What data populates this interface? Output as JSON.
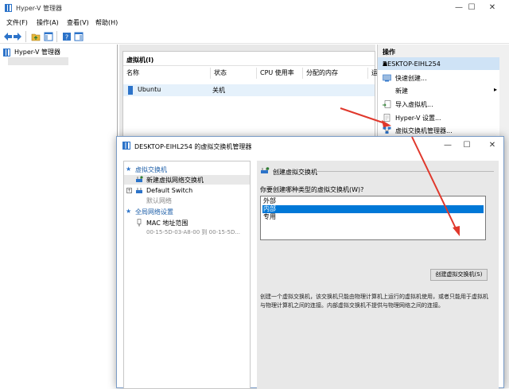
{
  "window": {
    "title": "Hyper-V 管理器",
    "controls": [
      "—",
      "☐",
      "✕"
    ]
  },
  "menu": [
    "文件(F)",
    "操作(A)",
    "查看(V)",
    "帮助(H)"
  ],
  "tree": {
    "root": "Hyper-V 管理器"
  },
  "vm_panel": {
    "title": "虚拟机(I)",
    "columns": [
      "名称",
      "状态",
      "CPU 使用率",
      "分配的内存",
      "运"
    ],
    "rows": [
      {
        "name": "Ubuntu",
        "state": "关机"
      }
    ]
  },
  "actions": {
    "header": "操作",
    "host": "DESKTOP-EIHL254",
    "items": [
      {
        "label": "快速创建...",
        "icon": "quick-create-icon"
      },
      {
        "label": "新建",
        "icon": "",
        "submenu": "▸"
      },
      {
        "label": "导入虚拟机...",
        "icon": "import-icon"
      },
      {
        "label": "Hyper-V 设置...",
        "icon": "settings-icon"
      },
      {
        "label": "虚拟交换机管理器...",
        "icon": "switch-manager-icon"
      }
    ]
  },
  "dialog": {
    "title": "DESKTOP-EIHL254 的虚拟交换机管理器",
    "controls": [
      "—",
      "☐",
      "✕"
    ],
    "left": {
      "section_switches": "虚拟交换机",
      "new_switch": "新建虚拟网络交换机",
      "default_switch": "Default Switch",
      "default_switch_sub": "默认网络",
      "section_global": "全局网络设置",
      "mac_range": "MAC 地址范围",
      "mac_value": "00-15-5D-03-A8-00 到 00-15-5D..."
    },
    "right": {
      "header": "创建虚拟交换机",
      "question": "你要创建哪种类型的虚拟交换机(W)?",
      "options": [
        "外部",
        "内部",
        "专用"
      ],
      "selected_index": 1,
      "create_button": "创建虚拟交换机(S)",
      "description": "创建一个虚拟交换机，该交换机只能由物理计算机上运行的虚拟机使用，或者只能用于虚拟机与物理计算机之间的连接。内部虚拟交换机不提供与物理网络之间的连接。"
    }
  },
  "colors": {
    "accent": "#0078d7",
    "selection": "#cfe3f6",
    "arrow": "#e0382c"
  }
}
